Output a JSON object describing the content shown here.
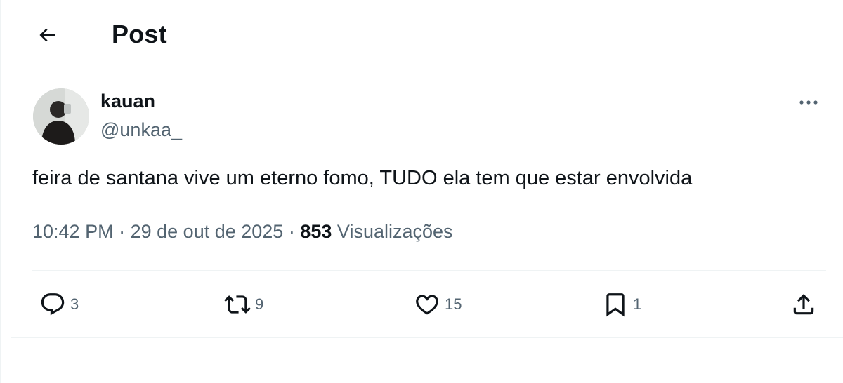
{
  "header": {
    "back_icon": "arrow-left-icon",
    "title": "Post"
  },
  "author": {
    "display_name": "kauan",
    "handle": "@unkaa_"
  },
  "post": {
    "text": "feira de santana vive um eterno fomo, TUDO ela tem que estar envolvida",
    "time": "10:42 PM",
    "separator": "·",
    "date": "29 de out de 2025",
    "views_count": "853",
    "views_label": "Visualizações"
  },
  "actions": {
    "replies": "3",
    "reposts": "9",
    "likes": "15",
    "bookmarks": "1"
  },
  "icons": {
    "reply": "reply-icon",
    "repost": "repost-icon",
    "like": "heart-icon",
    "bookmark": "bookmark-icon",
    "share": "share-icon",
    "more": "more-icon"
  },
  "colors": {
    "text_primary": "#0f1419",
    "text_secondary": "#536471",
    "divider": "#eff3f4"
  }
}
